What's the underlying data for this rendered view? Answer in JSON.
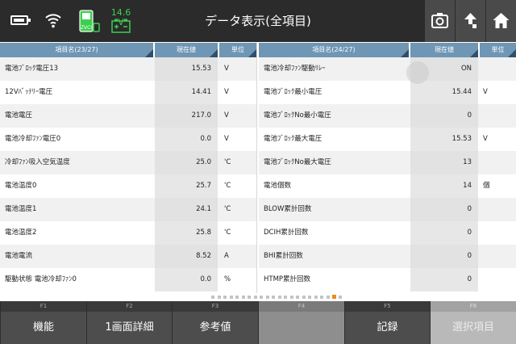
{
  "header": {
    "title": "データ表示(全項目)",
    "voltage": "14.6 V",
    "vci_label": "ZVCI",
    "icons": [
      "battery-icon",
      "wifi-icon",
      "zvci-icon",
      "car-battery-icon",
      "print-icon",
      "up-icon",
      "home-icon"
    ]
  },
  "colors": {
    "header_bg": "#2b2b2b",
    "table_header": "#6f96b4",
    "voltage_green": "#3ccf4e",
    "pager_active": "#f08a1c"
  },
  "left_table": {
    "headers": {
      "name": "項目名(23/27)",
      "value": "現在値",
      "unit": "単位"
    },
    "rows": [
      {
        "name": "電池ﾌﾞﾛｯｸ電圧13",
        "value": "15.53",
        "unit": "V"
      },
      {
        "name": "12Vﾊﾞｯﾃﾘｰ電圧",
        "value": "14.41",
        "unit": "V"
      },
      {
        "name": "電池電圧",
        "value": "217.0",
        "unit": "V"
      },
      {
        "name": "電池冷却ﾌｧﾝ電圧0",
        "value": "0.0",
        "unit": "V"
      },
      {
        "name": "冷却ﾌｧﾝ吸入空気温度",
        "value": "25.0",
        "unit": "'C"
      },
      {
        "name": "電池温度0",
        "value": "25.7",
        "unit": "'C"
      },
      {
        "name": "電池温度1",
        "value": "24.1",
        "unit": "'C"
      },
      {
        "name": "電池温度2",
        "value": "25.8",
        "unit": "'C"
      },
      {
        "name": "電池電流",
        "value": "8.52",
        "unit": "A"
      },
      {
        "name": "駆動状態 電池冷却ﾌｧﾝ0",
        "value": "0.0",
        "unit": "%"
      }
    ]
  },
  "right_table": {
    "headers": {
      "name": "項目名(24/27)",
      "value": "現在値",
      "unit": "単位"
    },
    "rows": [
      {
        "name": "電池冷却ﾌｧﾝ駆動ﾘﾚｰ",
        "value": "ON",
        "unit": ""
      },
      {
        "name": "電池ﾌﾞﾛｯｸ最小電圧",
        "value": "15.44",
        "unit": "V"
      },
      {
        "name": "電池ﾌﾞﾛｯｸNo最小電圧",
        "value": "0",
        "unit": ""
      },
      {
        "name": "電池ﾌﾞﾛｯｸ最大電圧",
        "value": "15.53",
        "unit": "V"
      },
      {
        "name": "電池ﾌﾞﾛｯｸNo最大電圧",
        "value": "13",
        "unit": ""
      },
      {
        "name": "電池個数",
        "value": "14",
        "unit": "個"
      },
      {
        "name": "BLOW累計回数",
        "value": "0",
        "unit": ""
      },
      {
        "name": "DCIH累計回数",
        "value": "0",
        "unit": ""
      },
      {
        "name": "BHI累計回数",
        "value": "0",
        "unit": ""
      },
      {
        "name": "HTMP累計回数",
        "value": "0",
        "unit": ""
      }
    ]
  },
  "pager": {
    "total": 22,
    "active": 20
  },
  "function_keys": [
    {
      "fn": "F1",
      "label": "機能",
      "state": "enabled"
    },
    {
      "fn": "F2",
      "label": "1画面詳細",
      "state": "enabled"
    },
    {
      "fn": "F3",
      "label": "参考値",
      "state": "enabled"
    },
    {
      "fn": "F4",
      "label": "",
      "state": "disabled"
    },
    {
      "fn": "F5",
      "label": "記録",
      "state": "enabled"
    },
    {
      "fn": "F6",
      "label": "選択項目",
      "state": "dim"
    }
  ]
}
